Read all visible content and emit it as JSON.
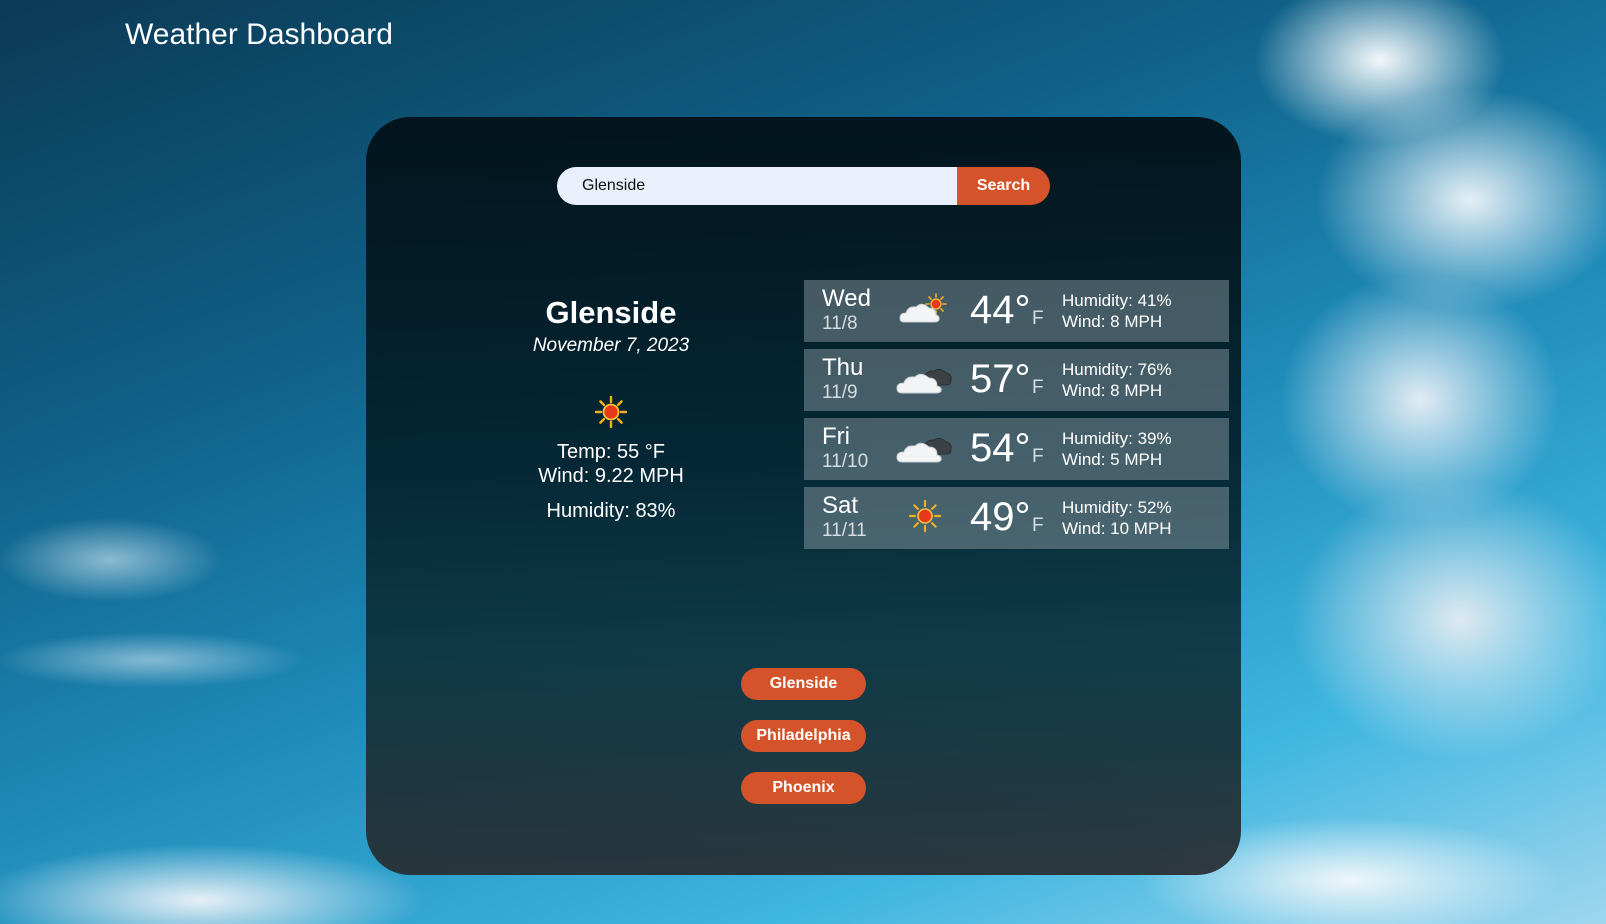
{
  "header": {
    "title": "Weather Dashboard"
  },
  "search": {
    "value": "Glenside",
    "button_label": "Search"
  },
  "current": {
    "city": "Glenside",
    "date": "November 7, 2023",
    "icon": "sun-icon",
    "temp": "Temp: 55 °F",
    "wind": "Wind: 9.22 MPH",
    "humidity": "Humidity: 83%"
  },
  "forecast": [
    {
      "day": "Wed",
      "date": "11/8",
      "icon": "partly-sunny-icon",
      "temp": "44°",
      "unit": "F",
      "humidity": "Humidity: 41%",
      "wind": "Wind: 8 MPH"
    },
    {
      "day": "Thu",
      "date": "11/9",
      "icon": "cloudy-icon",
      "temp": "57°",
      "unit": "F",
      "humidity": "Humidity: 76%",
      "wind": "Wind: 8 MPH"
    },
    {
      "day": "Fri",
      "date": "11/10",
      "icon": "cloudy-icon",
      "temp": "54°",
      "unit": "F",
      "humidity": "Humidity: 39%",
      "wind": "Wind: 5 MPH"
    },
    {
      "day": "Sat",
      "date": "11/11",
      "icon": "sun-icon",
      "temp": "49°",
      "unit": "F",
      "humidity": "Humidity: 52%",
      "wind": "Wind: 10 MPH"
    }
  ],
  "history": [
    "Glenside",
    "Philadelphia",
    "Phoenix"
  ],
  "colors": {
    "accent": "#d4532b",
    "input_bg": "#e9f0fb"
  }
}
